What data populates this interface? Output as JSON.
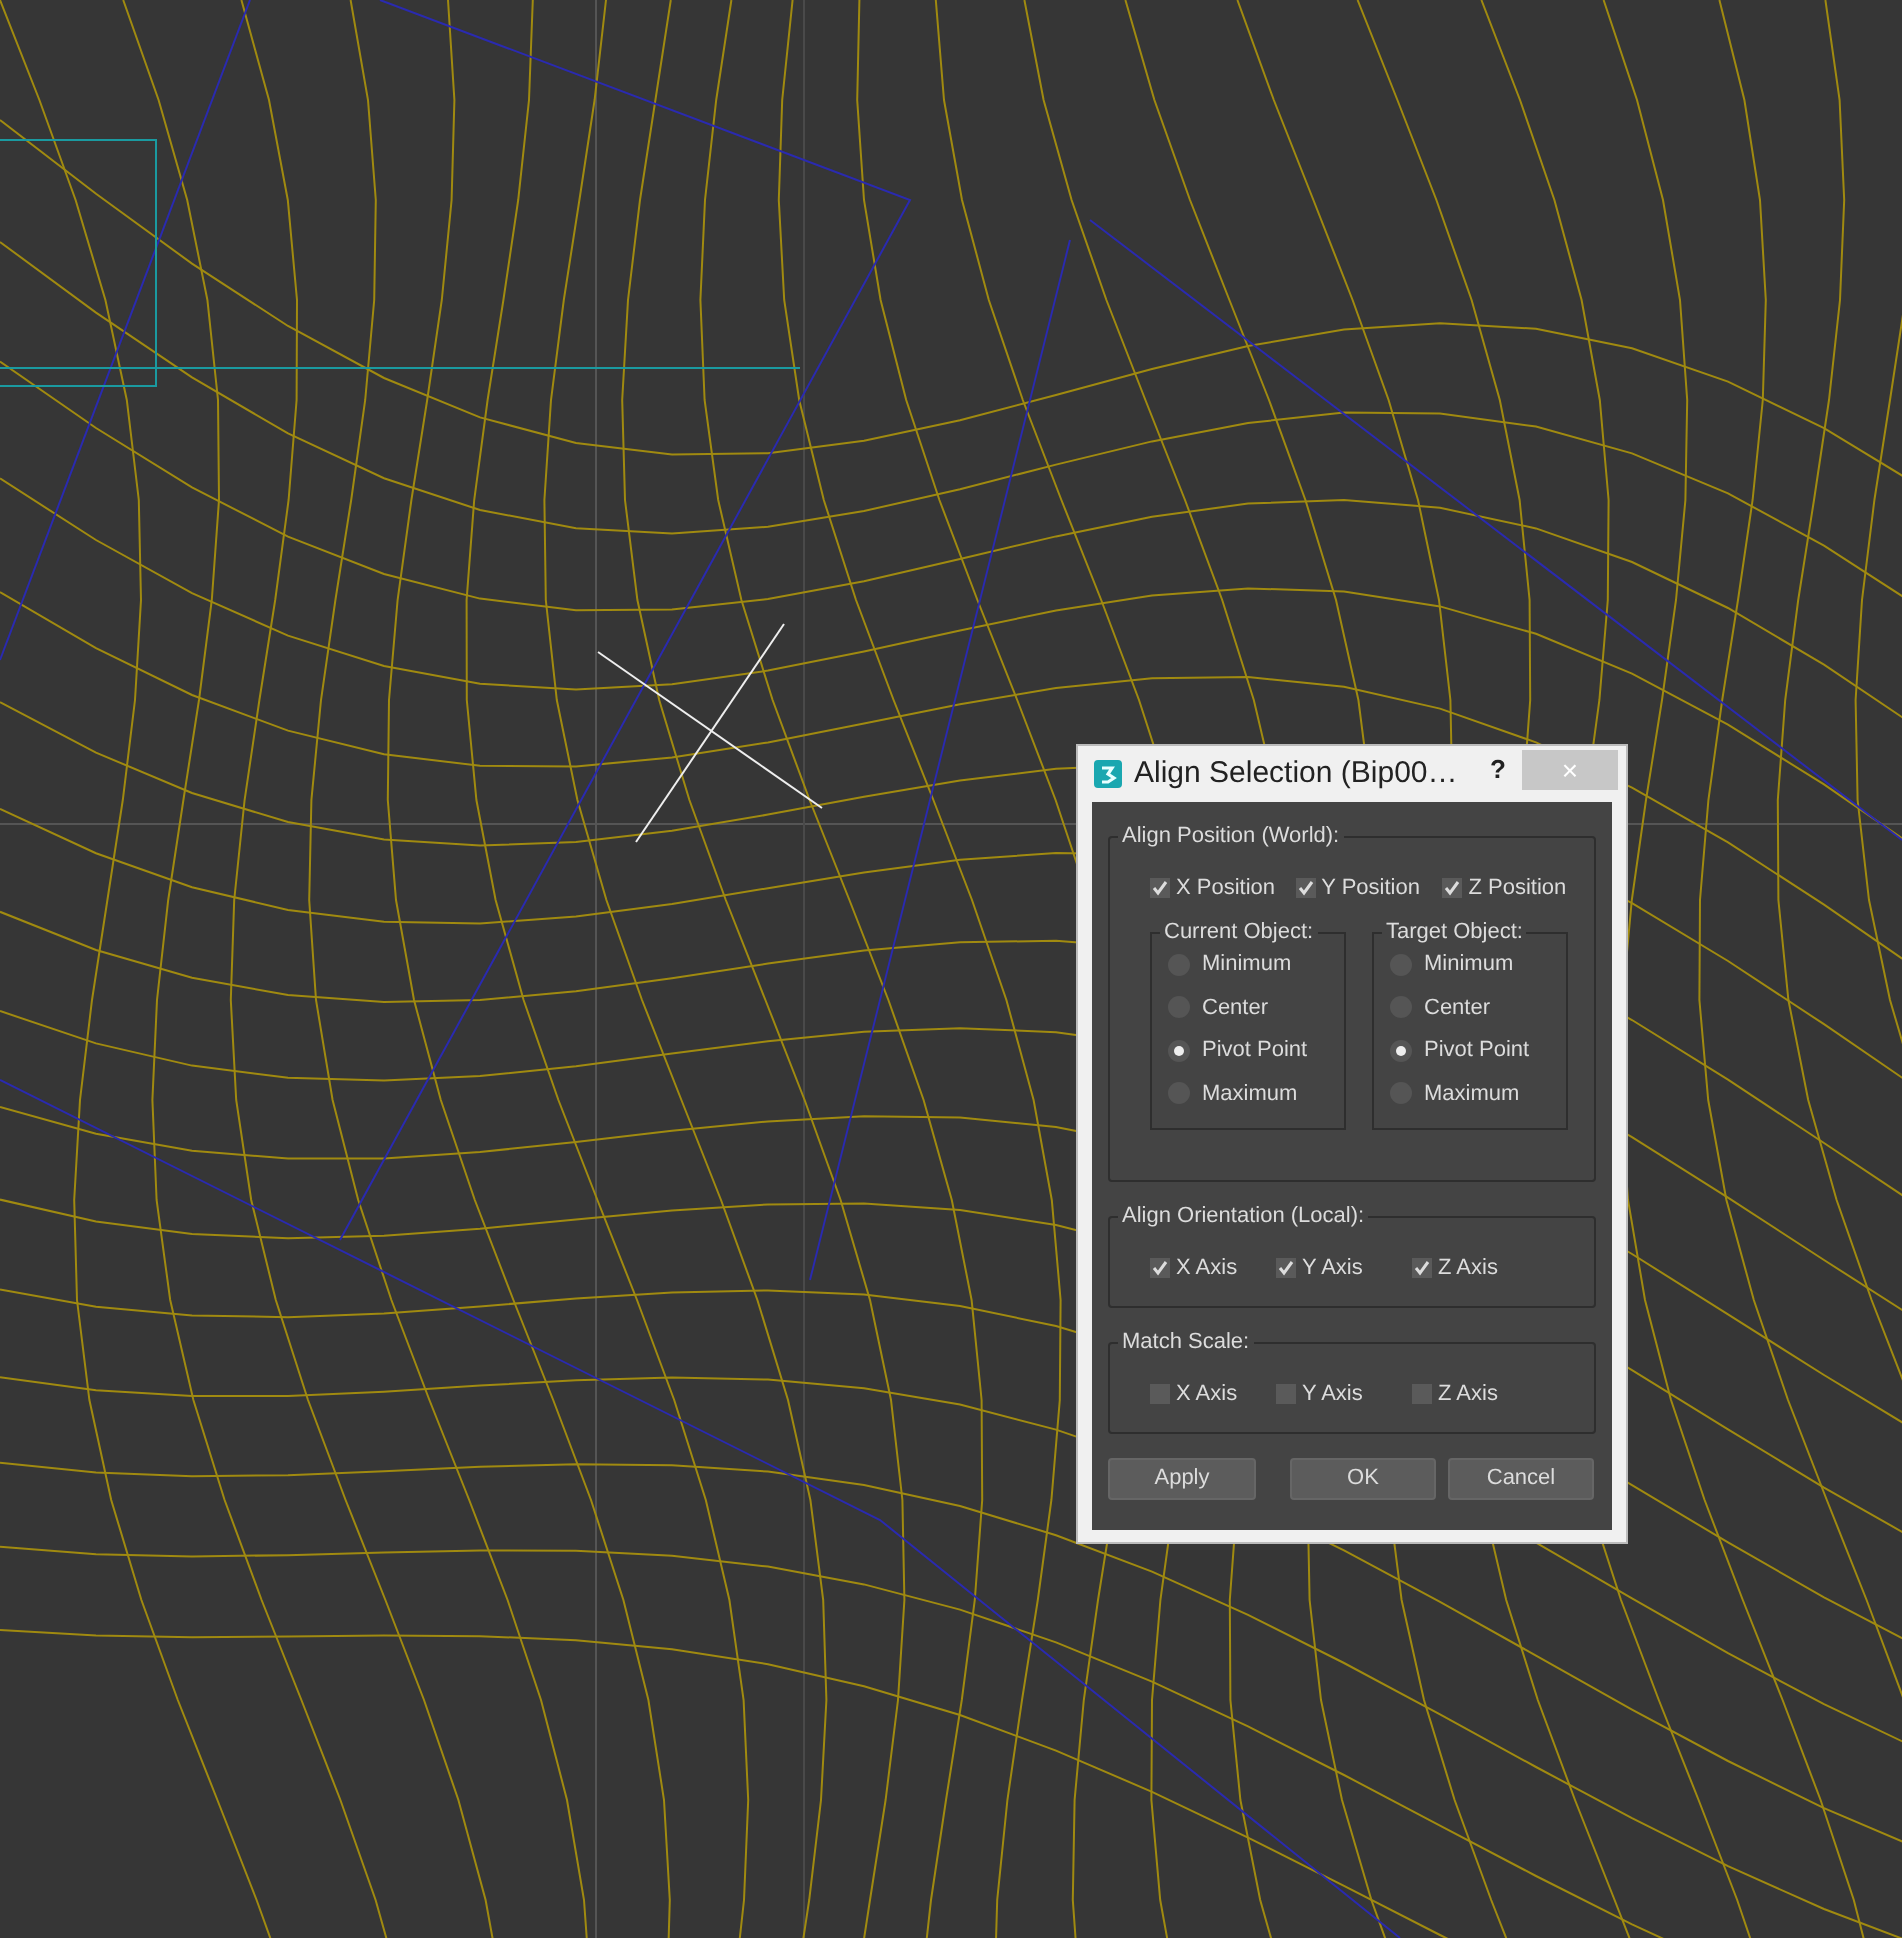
{
  "window": {
    "title": "Align Selection (Bip00…",
    "help": "?",
    "close": "×"
  },
  "align_position": {
    "label": "Align Position (World):",
    "axes": [
      {
        "label": "X Position",
        "checked": true
      },
      {
        "label": "Y Position",
        "checked": true
      },
      {
        "label": "Z Position",
        "checked": true
      }
    ],
    "groups": [
      {
        "label": "Current Object:",
        "options": [
          {
            "label": "Minimum",
            "selected": false
          },
          {
            "label": "Center",
            "selected": false
          },
          {
            "label": "Pivot Point",
            "selected": true
          },
          {
            "label": "Maximum",
            "selected": false
          }
        ]
      },
      {
        "label": "Target Object:",
        "options": [
          {
            "label": "Minimum",
            "selected": false
          },
          {
            "label": "Center",
            "selected": false
          },
          {
            "label": "Pivot Point",
            "selected": true
          },
          {
            "label": "Maximum",
            "selected": false
          }
        ]
      }
    ]
  },
  "align_orientation": {
    "label": "Align Orientation (Local):",
    "axes": [
      {
        "label": "X Axis",
        "checked": true
      },
      {
        "label": "Y Axis",
        "checked": true
      },
      {
        "label": "Z Axis",
        "checked": true
      }
    ]
  },
  "match_scale": {
    "label": "Match Scale:",
    "axes": [
      {
        "label": "X Axis",
        "checked": false
      },
      {
        "label": "Y Axis",
        "checked": false
      },
      {
        "label": "Z Axis",
        "checked": false
      }
    ]
  },
  "buttons": [
    "Apply",
    "OK",
    "Cancel"
  ]
}
